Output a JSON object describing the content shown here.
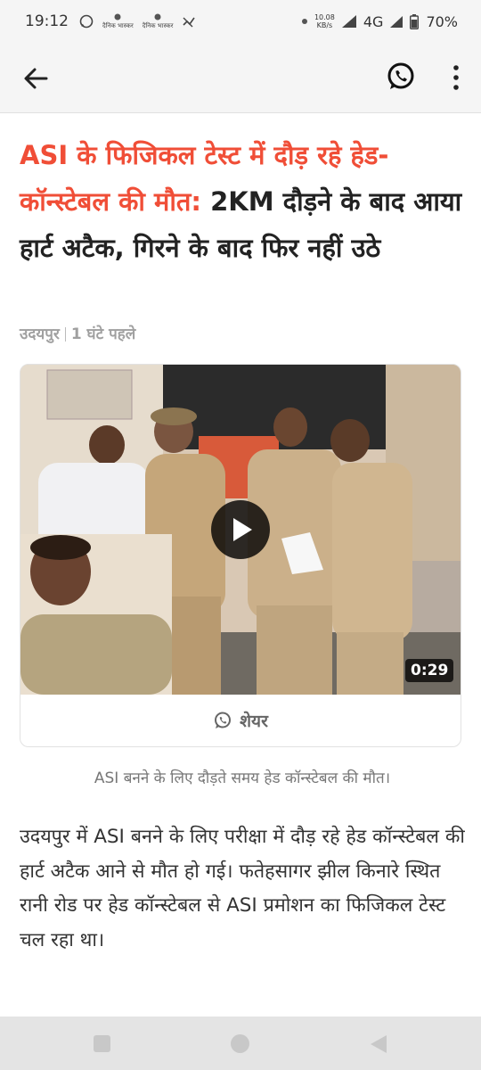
{
  "status_bar": {
    "time": "19:12",
    "notification_icons": [
      "whatsapp-icon",
      "dainik-bhaskar-icon",
      "dainik-bhaskar-icon",
      "missed-call-icon"
    ],
    "mini_logo_text": "दैनिक भास्कर",
    "net_speed_value": "10.08",
    "net_speed_unit": "KB/s",
    "network": "4G",
    "battery": "70%"
  },
  "app_bar": {
    "back_icon": "arrow-left-icon",
    "share_icon": "whatsapp-icon",
    "menu_icon": "more-vertical-icon"
  },
  "article": {
    "headline_highlight": "ASI के फिजिकल टेस्ट में दौड़ रहे हेड-कॉन्स्टेबल की मौत:",
    "headline_rest": " 2KM दौड़ने के बाद आया हार्ट अटैक, गिरने के बाद फिर नहीं उठे",
    "location": "उदयपुर",
    "time_ago": "1 घंटे पहले",
    "video_duration": "0:29",
    "share_label": "शेयर",
    "caption": "ASI बनने के लिए दौड़ते समय हेड कॉन्स्टेबल की मौत।",
    "body": "उदयपुर में ASI बनने के लिए परीक्षा में दौड़ रहे हेड कॉन्स्टेबल की हार्ट अटैक आने से मौत हो गई। फतेहसागर झील किनारे स्थित रानी रोड पर हेड कॉन्स्टेबल से ASI प्रमोशन का फिजिकल टेस्ट चल रहा था।"
  },
  "colors": {
    "headline_accent": "#f04e37",
    "background": "#ffffff",
    "bars": "#f5f5f5"
  }
}
